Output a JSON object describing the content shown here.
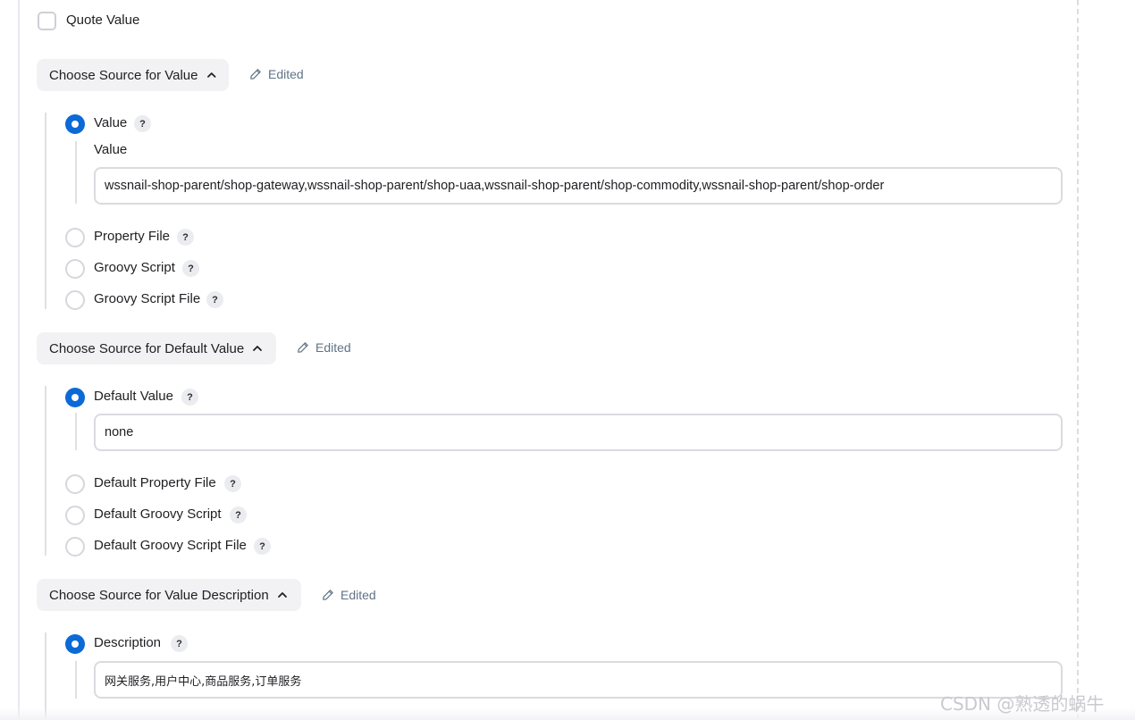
{
  "quote_value": {
    "label": "Quote Value",
    "checked": false
  },
  "edited_label": "Edited",
  "help_glyph": "?",
  "sections": [
    {
      "dropdown_label": "Choose Source for Value",
      "selected_field_label": "Value",
      "options": [
        {
          "label": "Value",
          "selected": true
        },
        {
          "label": "Property File",
          "selected": false
        },
        {
          "label": "Groovy Script",
          "selected": false
        },
        {
          "label": "Groovy Script File",
          "selected": false
        }
      ],
      "input_value": "wssnail-shop-parent/shop-gateway,wssnail-shop-parent/shop-uaa,wssnail-shop-parent/shop-commodity,wssnail-shop-parent/shop-order"
    },
    {
      "dropdown_label": "Choose Source for Default Value",
      "options": [
        {
          "label": "Default Value",
          "selected": true
        },
        {
          "label": "Default Property File",
          "selected": false
        },
        {
          "label": "Default Groovy Script",
          "selected": false
        },
        {
          "label": "Default Groovy Script File",
          "selected": false
        }
      ],
      "input_value": "none"
    },
    {
      "dropdown_label": "Choose Source for Value Description",
      "options": [
        {
          "label": "Description",
          "selected": true
        }
      ],
      "input_value": "网关服务,用户中心,商品服务,订单服务"
    }
  ],
  "watermark": "CSDN @熟透的蜗牛",
  "colors": {
    "accent": "#0b6ad6",
    "edited_text": "#5f7386",
    "dropdown_bg": "#f2f2f5"
  },
  "icons": {
    "edited": "pencil-icon",
    "dropdown": "chevron-up-icon",
    "help": "help-icon"
  }
}
